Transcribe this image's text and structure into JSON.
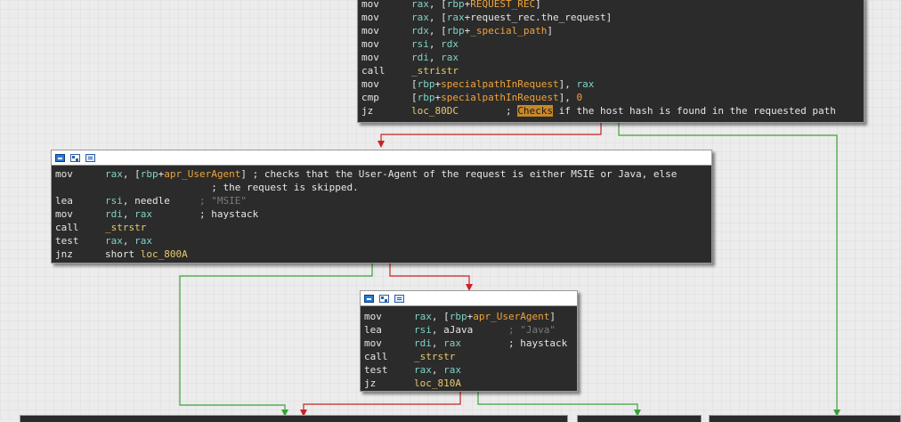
{
  "node_top": {
    "lines": [
      {
        "mn": "mov",
        "parts": [
          {
            "t": "rax",
            "c": "reg"
          },
          {
            "t": ", [",
            "c": "txt"
          },
          {
            "t": "rbp",
            "c": "reg"
          },
          {
            "t": "+",
            "c": "txt"
          },
          {
            "t": "REQUEST_REC",
            "c": "var"
          },
          {
            "t": "]",
            "c": "txt"
          }
        ]
      },
      {
        "mn": "mov",
        "parts": [
          {
            "t": "rax",
            "c": "reg"
          },
          {
            "t": ", [",
            "c": "txt"
          },
          {
            "t": "rax",
            "c": "reg"
          },
          {
            "t": "+request_rec.the_request]",
            "c": "txt"
          }
        ]
      },
      {
        "mn": "mov",
        "parts": [
          {
            "t": "rdx",
            "c": "reg"
          },
          {
            "t": ", [",
            "c": "txt"
          },
          {
            "t": "rbp",
            "c": "reg"
          },
          {
            "t": "+",
            "c": "txt"
          },
          {
            "t": "_special_path",
            "c": "var"
          },
          {
            "t": "]",
            "c": "txt"
          }
        ]
      },
      {
        "mn": "mov",
        "parts": [
          {
            "t": "rsi",
            "c": "reg"
          },
          {
            "t": ", ",
            "c": "txt"
          },
          {
            "t": "rdx",
            "c": "reg"
          }
        ]
      },
      {
        "mn": "mov",
        "parts": [
          {
            "t": "rdi",
            "c": "reg"
          },
          {
            "t": ", ",
            "c": "txt"
          },
          {
            "t": "rax",
            "c": "reg"
          }
        ]
      },
      {
        "mn": "call",
        "parts": [
          {
            "t": "_stristr",
            "c": "fn"
          }
        ]
      },
      {
        "mn": "mov",
        "parts": [
          {
            "t": "[",
            "c": "txt"
          },
          {
            "t": "rbp",
            "c": "reg"
          },
          {
            "t": "+",
            "c": "txt"
          },
          {
            "t": "specialpathInRequest",
            "c": "var"
          },
          {
            "t": "], ",
            "c": "txt"
          },
          {
            "t": "rax",
            "c": "reg"
          }
        ]
      },
      {
        "mn": "cmp",
        "parts": [
          {
            "t": "[",
            "c": "txt"
          },
          {
            "t": "rbp",
            "c": "reg"
          },
          {
            "t": "+",
            "c": "txt"
          },
          {
            "t": "specialpathInRequest",
            "c": "var"
          },
          {
            "t": "], ",
            "c": "txt"
          },
          {
            "t": "0",
            "c": "num"
          }
        ]
      },
      {
        "mn": "jz",
        "parts": [
          {
            "t": "loc_80DC",
            "c": "lbl"
          },
          {
            "t": "        ; ",
            "c": "cmt"
          },
          {
            "t": "Checks",
            "c": "hl"
          },
          {
            "t": " if the host hash is found in the requested path",
            "c": "cmt"
          }
        ]
      }
    ]
  },
  "node_msie": {
    "lines": [
      {
        "mn": "mov",
        "parts": [
          {
            "t": "rax",
            "c": "reg"
          },
          {
            "t": ", [",
            "c": "txt"
          },
          {
            "t": "rbp",
            "c": "reg"
          },
          {
            "t": "+",
            "c": "txt"
          },
          {
            "t": "apr_UserAgent",
            "c": "var"
          },
          {
            "t": "] ; checks that the User-Agent of the request is either MSIE or Java, else",
            "c": "cmt"
          }
        ]
      },
      {
        "mn": "",
        "parts": [
          {
            "t": "                  ; the request is skipped.",
            "c": "cmt"
          }
        ]
      },
      {
        "mn": "lea",
        "parts": [
          {
            "t": "rsi",
            "c": "reg"
          },
          {
            "t": ", needle     ",
            "c": "txt"
          },
          {
            "t": "; \"MSIE\"",
            "c": "str"
          }
        ]
      },
      {
        "mn": "mov",
        "parts": [
          {
            "t": "rdi",
            "c": "reg"
          },
          {
            "t": ", ",
            "c": "txt"
          },
          {
            "t": "rax",
            "c": "reg"
          },
          {
            "t": "        ; haystack",
            "c": "cmt"
          }
        ]
      },
      {
        "mn": "call",
        "parts": [
          {
            "t": "_strstr",
            "c": "fn"
          }
        ]
      },
      {
        "mn": "test",
        "parts": [
          {
            "t": "rax",
            "c": "reg"
          },
          {
            "t": ", ",
            "c": "txt"
          },
          {
            "t": "rax",
            "c": "reg"
          }
        ]
      },
      {
        "mn": "jnz",
        "parts": [
          {
            "t": "short ",
            "c": "txt"
          },
          {
            "t": "loc_800A",
            "c": "lbl"
          }
        ]
      }
    ]
  },
  "node_java": {
    "lines": [
      {
        "mn": "mov",
        "parts": [
          {
            "t": "rax",
            "c": "reg"
          },
          {
            "t": ", [",
            "c": "txt"
          },
          {
            "t": "rbp",
            "c": "reg"
          },
          {
            "t": "+",
            "c": "txt"
          },
          {
            "t": "apr_UserAgent",
            "c": "var"
          },
          {
            "t": "]",
            "c": "txt"
          }
        ]
      },
      {
        "mn": "lea",
        "parts": [
          {
            "t": "rsi",
            "c": "reg"
          },
          {
            "t": ", aJava      ",
            "c": "txt"
          },
          {
            "t": "; \"Java\"",
            "c": "str"
          }
        ]
      },
      {
        "mn": "mov",
        "parts": [
          {
            "t": "rdi",
            "c": "reg"
          },
          {
            "t": ", ",
            "c": "txt"
          },
          {
            "t": "rax",
            "c": "reg"
          },
          {
            "t": "        ; haystack",
            "c": "cmt"
          }
        ]
      },
      {
        "mn": "call",
        "parts": [
          {
            "t": "_strstr",
            "c": "fn"
          }
        ]
      },
      {
        "mn": "test",
        "parts": [
          {
            "t": "rax",
            "c": "reg"
          },
          {
            "t": ", ",
            "c": "txt"
          },
          {
            "t": "rax",
            "c": "reg"
          }
        ]
      },
      {
        "mn": "jz",
        "parts": [
          {
            "t": "loc_810A",
            "c": "lbl"
          }
        ]
      }
    ]
  },
  "colors": {
    "node_bg": "#2b2b2b",
    "edge_true": "#3aa23a",
    "edge_false": "#cc2222",
    "register": "#7ed3c5",
    "label": "#e9c96c",
    "variable": "#f0a33a",
    "highlight": "#c7882a"
  },
  "icons": [
    "graph-overview-icon",
    "group-nodes-icon",
    "text-view-icon"
  ]
}
